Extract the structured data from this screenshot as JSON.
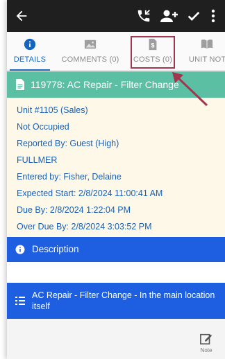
{
  "appbar": {
    "icons": [
      "back-arrow-icon",
      "phone-callback-icon",
      "add-person-icon",
      "checkmark-icon",
      "more-vert-icon"
    ]
  },
  "tabs": [
    {
      "label": "DETAILS",
      "icon": "info-icon",
      "active": true
    },
    {
      "label": "COMMENTS (0)",
      "icon": "image-icon",
      "active": false
    },
    {
      "label": "COSTS (0)",
      "icon": "dollar-document-icon",
      "active": false
    },
    {
      "label": "UNIT NOTE",
      "icon": "book-icon",
      "active": false
    }
  ],
  "work_order": {
    "title": "119778: AC Repair - Filter Change",
    "details": [
      "Unit #1105 (Sales)",
      "Not Occupied",
      "Reported By: Guest  (High)",
      "FULLMER",
      "Entered by: Fisher, Delaine",
      "Expected Start: 2/8/2024 11:00:41 AM",
      "Due By: 2/8/2024 1:22:04 PM",
      "Over Due By: 2/8/2024 3:03:52 PM"
    ]
  },
  "description": {
    "header": "Description",
    "item": "AC Repair - Filter Change - In the main location itself"
  },
  "footer": {
    "note_label": "Note"
  },
  "colors": {
    "appbar": "#1f1f1f",
    "active_tab": "#1565c0",
    "wo_header": "#5bbfa3",
    "details_bg": "#fdf8e7",
    "detail_text": "#1a5fb4",
    "description_bar": "#1e5ee0",
    "annotation": "#a3354e"
  }
}
